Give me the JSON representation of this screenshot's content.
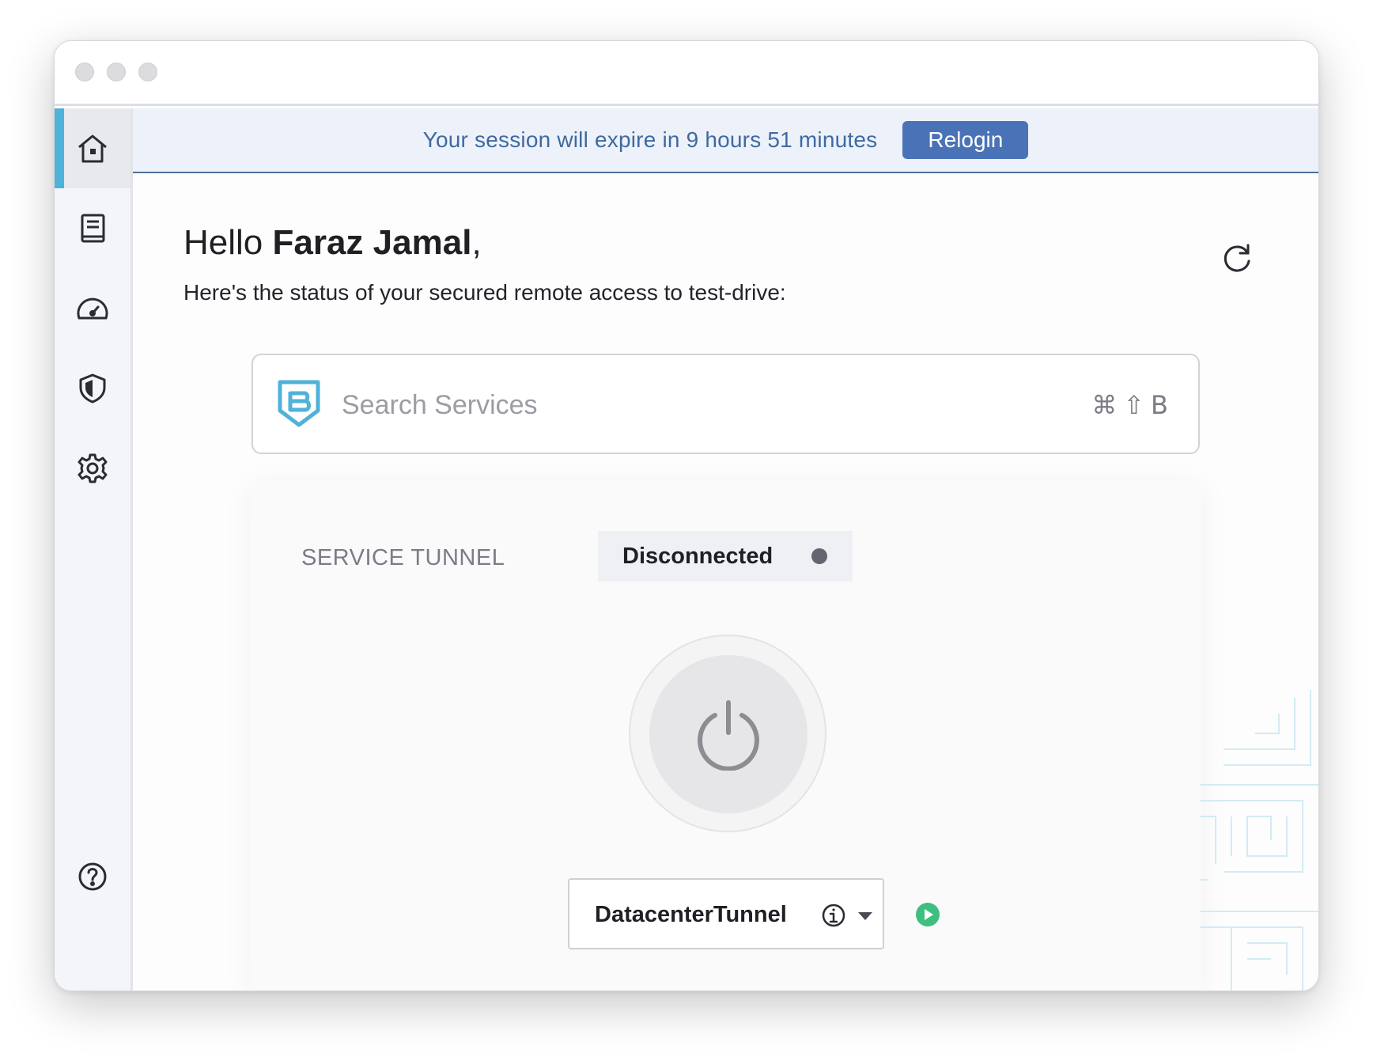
{
  "banner": {
    "message": "Your session will expire in 9 hours 51 minutes",
    "relogin_label": "Relogin"
  },
  "sidebar": {
    "items": [
      {
        "name": "home",
        "icon": "home-icon",
        "active": true
      },
      {
        "name": "logs",
        "icon": "book-icon",
        "active": false
      },
      {
        "name": "dashboard",
        "icon": "speedometer-icon",
        "active": false
      },
      {
        "name": "security",
        "icon": "shield-icon",
        "active": false
      },
      {
        "name": "settings",
        "icon": "gear-icon",
        "active": false
      },
      {
        "name": "help",
        "icon": "help-icon",
        "active": false
      }
    ]
  },
  "greeting": {
    "hello": "Hello ",
    "user_name": "Faraz Jamal",
    "suffix": ",",
    "subtitle": "Here's the status of your secured remote access to test-drive:"
  },
  "search": {
    "placeholder": "Search Services",
    "value": "",
    "shortcut": "⌘⇧B"
  },
  "tunnel": {
    "section_label": "SERVICE TUNNEL",
    "status": "Disconnected",
    "status_color": "#636672",
    "selected_tunnel": "DatacenterTunnel"
  },
  "colors": {
    "accent": "#4a73b7",
    "sidebar_active": "#4fb2d8",
    "play_green": "#3fbf7f",
    "logo_blue": "#4fb2d8"
  }
}
